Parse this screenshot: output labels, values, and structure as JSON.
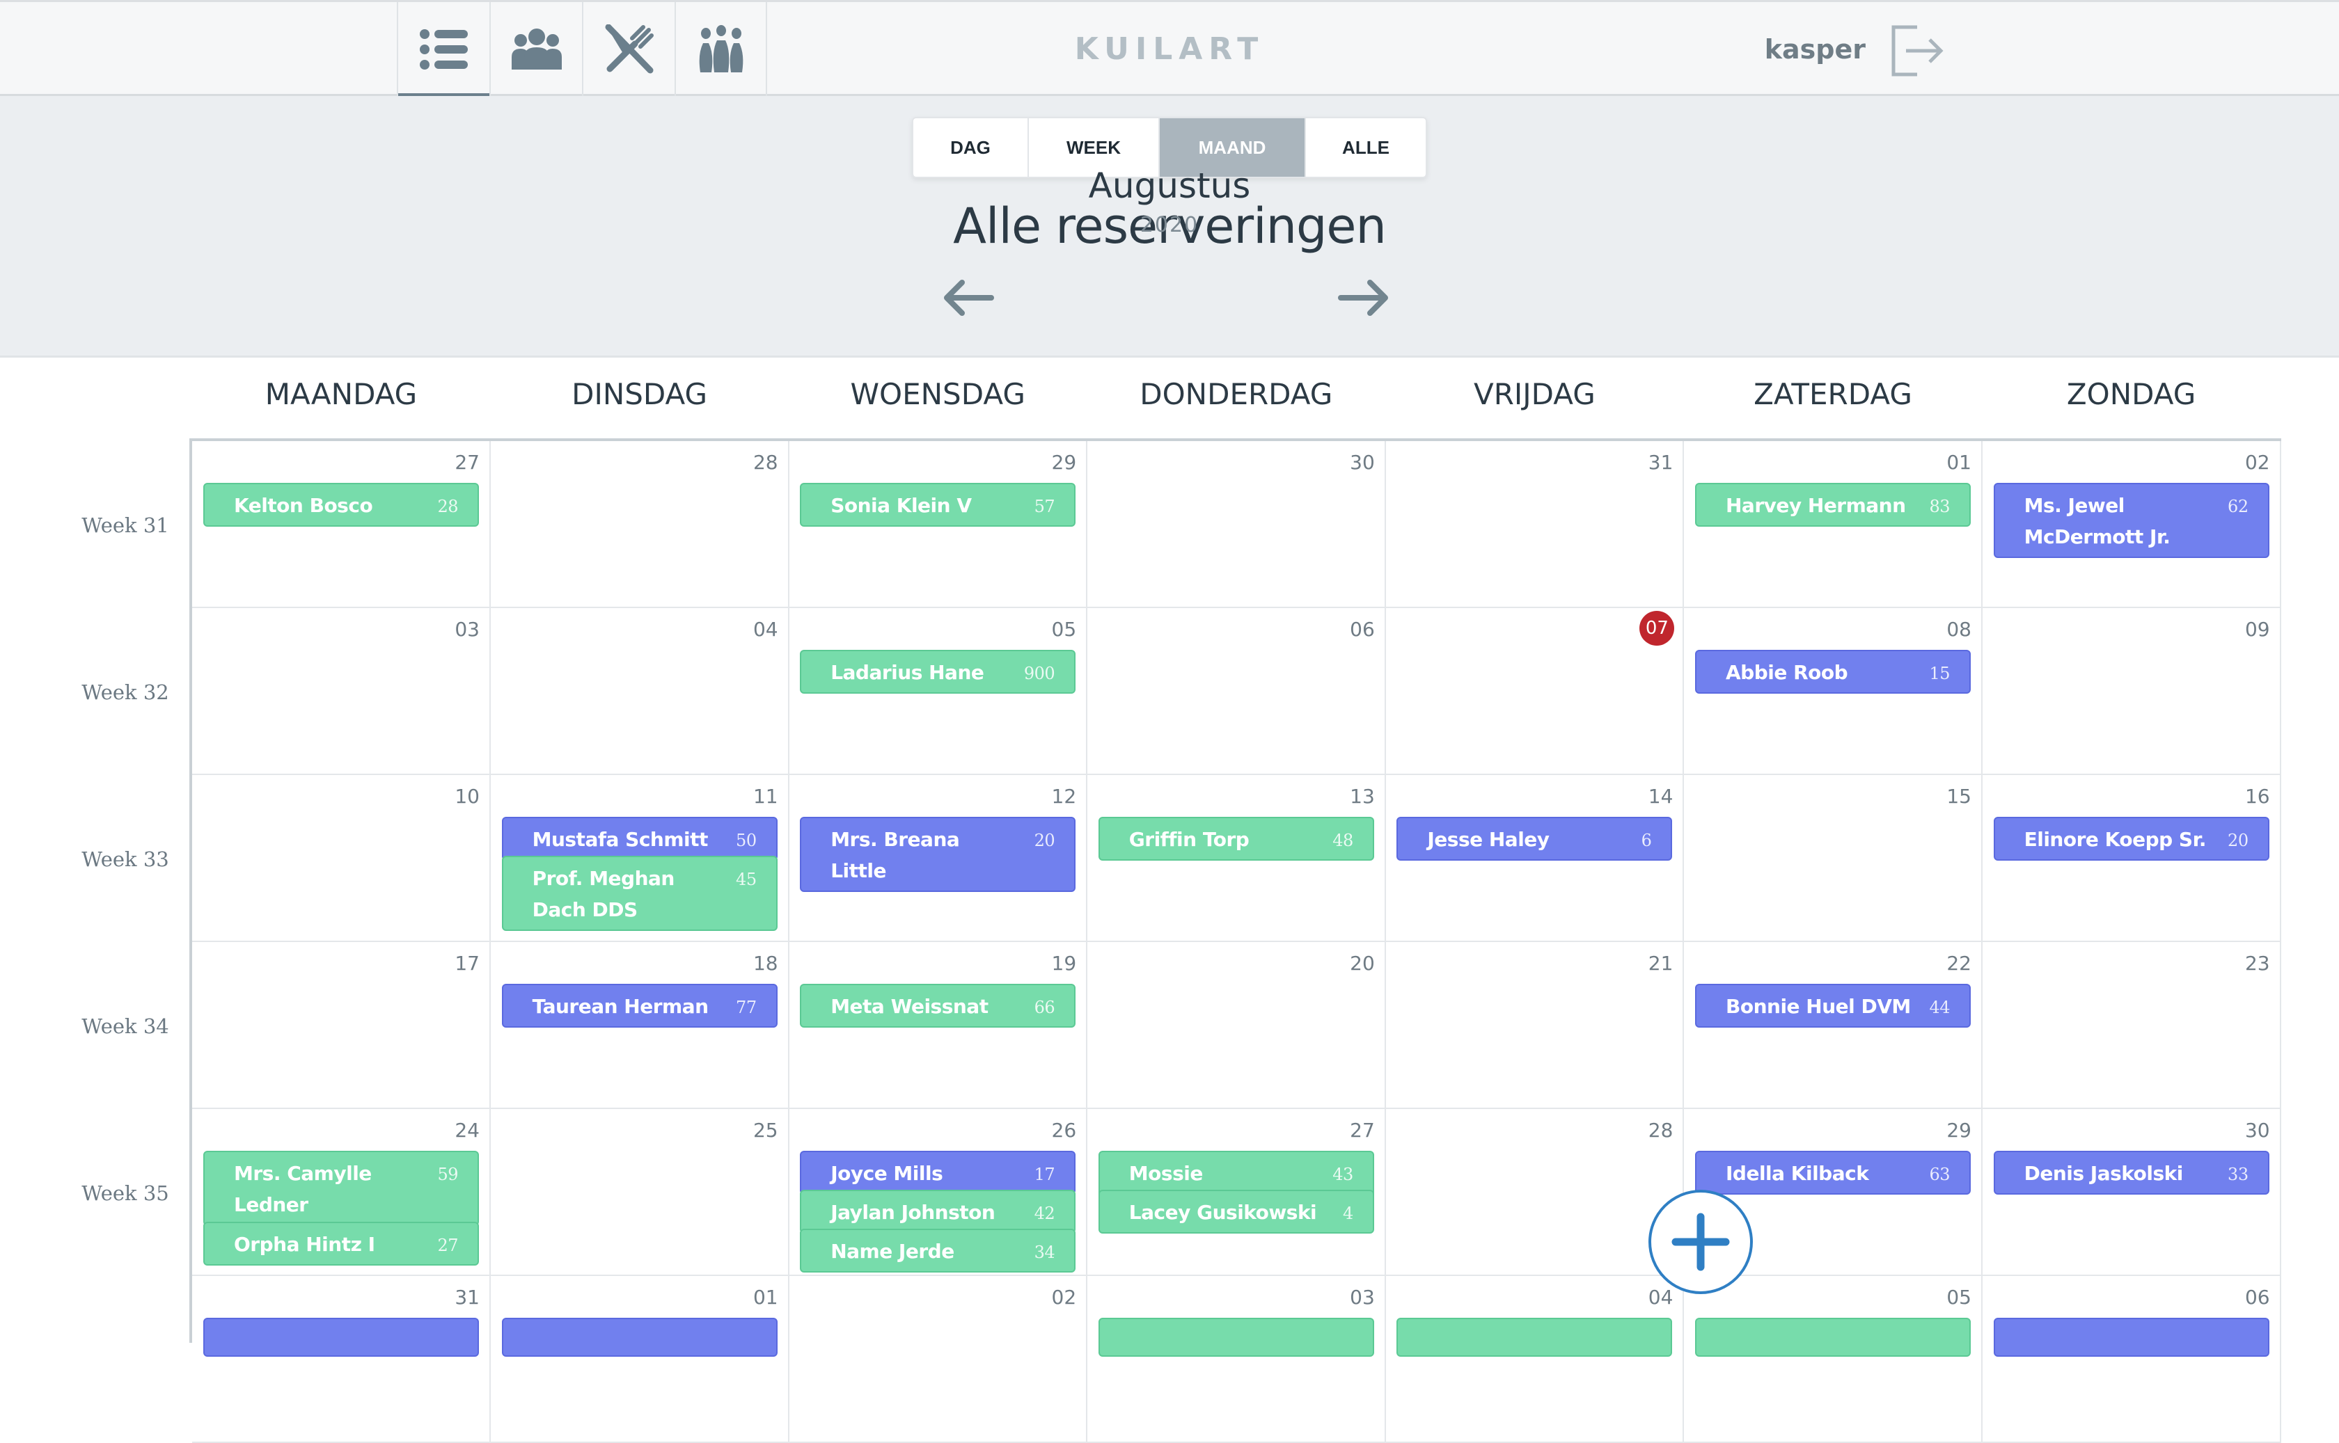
{
  "nav": {
    "tabs": [
      {
        "name": "list-icon",
        "active": true
      },
      {
        "name": "users-icon",
        "active": false
      },
      {
        "name": "fork-knife-icon",
        "active": false
      },
      {
        "name": "bowling-icon",
        "active": false
      }
    ],
    "brand": "KUILART",
    "user": "kasper",
    "logout_icon": "logout-icon"
  },
  "view_switch": [
    "DAG",
    "WEEK",
    "MAAND",
    "ALLE"
  ],
  "view_active": "MAAND",
  "header": {
    "title": "Alle reserveringen",
    "month": "Augustus",
    "year": "2020"
  },
  "days": [
    "MAANDAG",
    "DINSDAG",
    "WOENSDAG",
    "DONDERDAG",
    "VRIJDAG",
    "ZATERDAG",
    "ZONDAG"
  ],
  "weeks": [
    {
      "label": "Week 31",
      "days": [
        {
          "num": "27",
          "res": [
            {
              "name": "Kelton Bosco",
              "count": "28",
              "color": "green"
            }
          ]
        },
        {
          "num": "28",
          "res": []
        },
        {
          "num": "29",
          "res": [
            {
              "name": "Sonia Klein V",
              "count": "57",
              "color": "green"
            }
          ]
        },
        {
          "num": "30",
          "res": []
        },
        {
          "num": "31",
          "res": []
        },
        {
          "num": "01",
          "res": [
            {
              "name": "Harvey Hermann",
              "count": "83",
              "color": "green"
            }
          ]
        },
        {
          "num": "02",
          "res": [
            {
              "name": "Ms. Jewel McDermott Jr.",
              "count": "62",
              "color": "blue"
            }
          ]
        }
      ]
    },
    {
      "label": "Week 32",
      "days": [
        {
          "num": "03",
          "res": []
        },
        {
          "num": "04",
          "res": []
        },
        {
          "num": "05",
          "res": [
            {
              "name": "Ladarius Hane",
              "count": "900",
              "color": "green"
            }
          ]
        },
        {
          "num": "06",
          "res": []
        },
        {
          "num": "07",
          "today": true,
          "res": []
        },
        {
          "num": "08",
          "res": [
            {
              "name": "Abbie Roob",
              "count": "15",
              "color": "blue"
            }
          ]
        },
        {
          "num": "09",
          "res": []
        }
      ]
    },
    {
      "label": "Week 33",
      "days": [
        {
          "num": "10",
          "res": []
        },
        {
          "num": "11",
          "res": [
            {
              "name": "Mustafa Schmitt",
              "count": "50",
              "color": "blue"
            },
            {
              "name": "Prof. Meghan Dach DDS",
              "count": "45",
              "color": "green"
            }
          ]
        },
        {
          "num": "12",
          "res": [
            {
              "name": "Mrs. Breana Little",
              "count": "20",
              "color": "blue"
            }
          ]
        },
        {
          "num": "13",
          "res": [
            {
              "name": "Griffin Torp",
              "count": "48",
              "color": "green"
            }
          ]
        },
        {
          "num": "14",
          "res": [
            {
              "name": "Jesse Haley",
              "count": "6",
              "color": "blue"
            }
          ]
        },
        {
          "num": "15",
          "res": []
        },
        {
          "num": "16",
          "res": [
            {
              "name": "Elinore Koepp Sr.",
              "count": "20",
              "color": "blue"
            }
          ]
        }
      ]
    },
    {
      "label": "Week 34",
      "days": [
        {
          "num": "17",
          "res": []
        },
        {
          "num": "18",
          "res": [
            {
              "name": "Taurean Herman",
              "count": "77",
              "color": "blue"
            }
          ]
        },
        {
          "num": "19",
          "res": [
            {
              "name": "Meta Weissnat",
              "count": "66",
              "color": "green"
            }
          ]
        },
        {
          "num": "20",
          "res": []
        },
        {
          "num": "21",
          "res": []
        },
        {
          "num": "22",
          "res": [
            {
              "name": "Bonnie Huel DVM",
              "count": "44",
              "color": "blue"
            }
          ]
        },
        {
          "num": "23",
          "res": []
        }
      ]
    },
    {
      "label": "Week 35",
      "days": [
        {
          "num": "24",
          "res": [
            {
              "name": "Mrs. Camylle Ledner",
              "count": "59",
              "color": "green"
            },
            {
              "name": "Orpha Hintz I",
              "count": "27",
              "color": "green"
            }
          ]
        },
        {
          "num": "25",
          "res": []
        },
        {
          "num": "26",
          "res": [
            {
              "name": "Joyce Mills",
              "count": "17",
              "color": "blue"
            },
            {
              "name": "Jaylan Johnston",
              "count": "42",
              "color": "green"
            },
            {
              "name": "Name Jerde",
              "count": "34",
              "color": "green"
            }
          ]
        },
        {
          "num": "27",
          "res": [
            {
              "name": "Mossie Bergnaum",
              "count": "43",
              "color": "green"
            },
            {
              "name": "Lacey Gusikowski",
              "count": "4",
              "color": "green"
            }
          ]
        },
        {
          "num": "28",
          "res": []
        },
        {
          "num": "29",
          "res": [
            {
              "name": "Idella Kilback",
              "count": "63",
              "color": "blue"
            }
          ]
        },
        {
          "num": "30",
          "res": [
            {
              "name": "Denis Jaskolski",
              "count": "33",
              "color": "blue"
            }
          ]
        }
      ]
    },
    {
      "label": "",
      "days": [
        {
          "num": "31",
          "res": [
            {
              "name": "",
              "count": "",
              "color": "blue"
            }
          ]
        },
        {
          "num": "01",
          "res": [
            {
              "name": "",
              "count": "",
              "color": "blue"
            }
          ]
        },
        {
          "num": "02",
          "res": []
        },
        {
          "num": "03",
          "res": [
            {
              "name": "",
              "count": "",
              "color": "green"
            }
          ]
        },
        {
          "num": "04",
          "res": [
            {
              "name": "",
              "count": "",
              "color": "green"
            }
          ]
        },
        {
          "num": "05",
          "res": [
            {
              "name": "",
              "count": "",
              "color": "green"
            }
          ]
        },
        {
          "num": "06",
          "res": [
            {
              "name": "",
              "count": "",
              "color": "blue"
            }
          ]
        }
      ]
    }
  ],
  "fab_icon": "plus-icon",
  "colors": {
    "green": "#77dcab",
    "blue": "#7180ee",
    "today": "#c0262d",
    "fab": "#2f7fc4"
  }
}
